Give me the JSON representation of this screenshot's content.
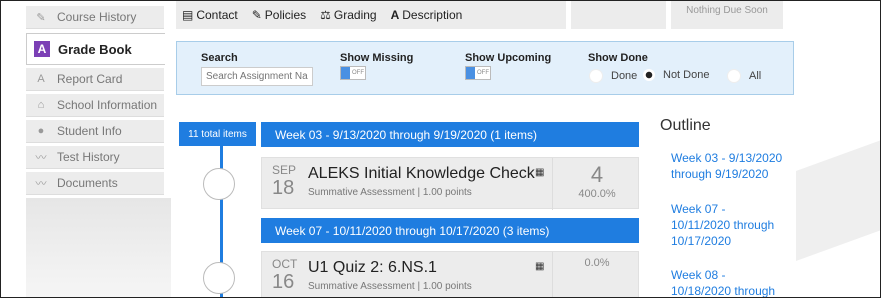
{
  "sidebar": {
    "items": [
      {
        "label": "Course History",
        "icon": "course-history-icon",
        "glyph": "✎"
      },
      {
        "label": "Grade Book",
        "icon": "grade-book-icon",
        "glyph": "A",
        "active": true
      },
      {
        "label": "Report Card",
        "icon": "report-card-icon",
        "glyph": "A"
      },
      {
        "label": "School Information",
        "icon": "school-icon",
        "glyph": "⌂"
      },
      {
        "label": "Student Info",
        "icon": "student-icon",
        "glyph": "●"
      },
      {
        "label": "Test History",
        "icon": "test-history-icon",
        "glyph": "〰"
      },
      {
        "label": "Documents",
        "icon": "documents-icon",
        "glyph": "〰"
      }
    ]
  },
  "toolbar": {
    "contact": "Contact",
    "policies": "Policies",
    "grading": "Grading",
    "description": "Description",
    "nothing_due": "Nothing Due Soon"
  },
  "filters": {
    "search_label": "Search",
    "search_placeholder": "Search Assignment Name",
    "show_missing": "Show Missing",
    "show_upcoming": "Show Upcoming",
    "show_done": "Show Done",
    "off": "OFF",
    "done_options": [
      "Done",
      "Not Done",
      "All"
    ],
    "done_selected": "Not Done"
  },
  "timeline": {
    "total": "11 total items",
    "weeks": [
      {
        "header": "Week 03 - 9/13/2020 through 9/19/2020  (1 items)"
      },
      {
        "header": "Week 07 - 10/11/2020 through 10/17/2020  (3 items)"
      }
    ],
    "assignments": [
      {
        "month": "SEP",
        "day": "18",
        "title": "ALEKS Initial Knowledge Check",
        "subtitle": "Summative Assessment | 1.00 points",
        "score": "4",
        "percent": "400.0%"
      },
      {
        "month": "OCT",
        "day": "16",
        "title": "U1 Quiz 2: 6.NS.1",
        "subtitle": "Summative Assessment | 1.00 points",
        "score": "",
        "percent": "0.0%"
      }
    ]
  },
  "outline": {
    "title": "Outline",
    "links": [
      "Week 03 - 9/13/2020 through 9/19/2020",
      "Week 07 - 10/11/2020 through 10/17/2020",
      "Week 08 - 10/18/2020 through"
    ]
  }
}
